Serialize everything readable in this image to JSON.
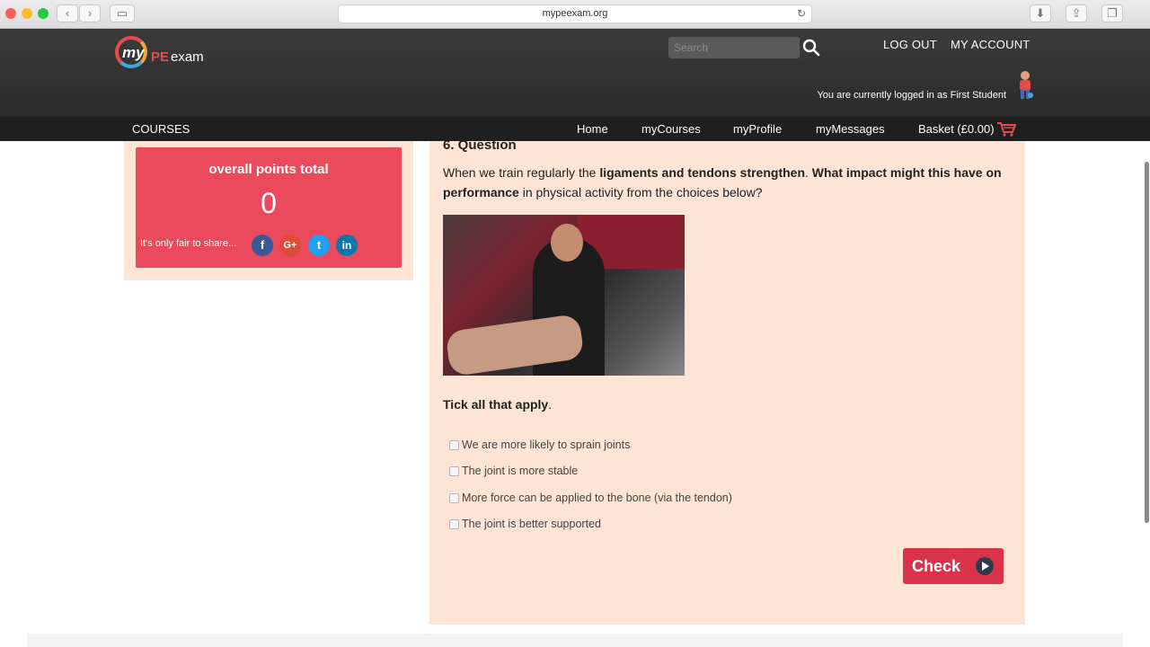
{
  "browser": {
    "url": "mypeexam.org"
  },
  "header": {
    "logo": {
      "my": "my",
      "pe": "PE",
      "exam": "exam"
    },
    "search_placeholder": "Search",
    "logout": "LOG OUT",
    "account": "MY ACCOUNT",
    "login_status": "You are currently logged in as First Student"
  },
  "nav": {
    "courses": "COURSES",
    "items": [
      "Home",
      "myCourses",
      "myProfile",
      "myMessages",
      "Basket (£0.00)"
    ]
  },
  "points": {
    "title": "overall points total",
    "value": "0",
    "share_text": "It's only fair to share...",
    "social": [
      "f",
      "G+",
      "t",
      "in"
    ]
  },
  "question": {
    "heading": "6. Question",
    "text_parts": [
      "When we train regularly the ",
      "ligaments and tendons strengthen",
      ". ",
      "What impact might this have on performance",
      " in physical activity from the choices below?"
    ],
    "instruction": "Tick all that apply",
    "options": [
      "We are more likely to sprain joints",
      "The joint is more stable",
      "More force can be applied to the bone (via the tendon)",
      "The joint is better supported"
    ],
    "check_label": "Check"
  },
  "colors": {
    "accent": "#eb4a5c",
    "button": "#d9344a",
    "panel_bg": "#fde4d4",
    "header_bg": "#2b2b2b"
  }
}
